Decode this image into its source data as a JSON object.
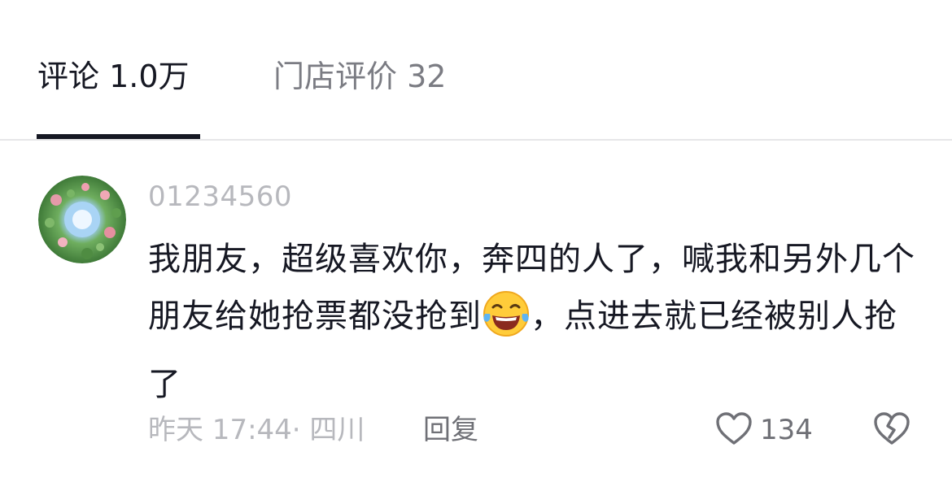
{
  "tabs": [
    {
      "label": "评论 1.0万"
    },
    {
      "label": "门店评价 32"
    }
  ],
  "comment": {
    "username": "01234560",
    "text_part1": "我朋友，超级喜欢你，奔四的人了，喊我和另外几个朋友给她抢票都没抢到",
    "emoji": "laughing-crying-emoji",
    "text_part2": "，点进去就已经被别人抢了",
    "time_location": "昨天 17:44· 四川",
    "reply_label": "回复",
    "like_count": "134"
  },
  "colors": {
    "primary_text": "#161823",
    "secondary_text": "#b7b8bd",
    "action_text": "#6f7076",
    "divider": "#e6e6e8"
  }
}
